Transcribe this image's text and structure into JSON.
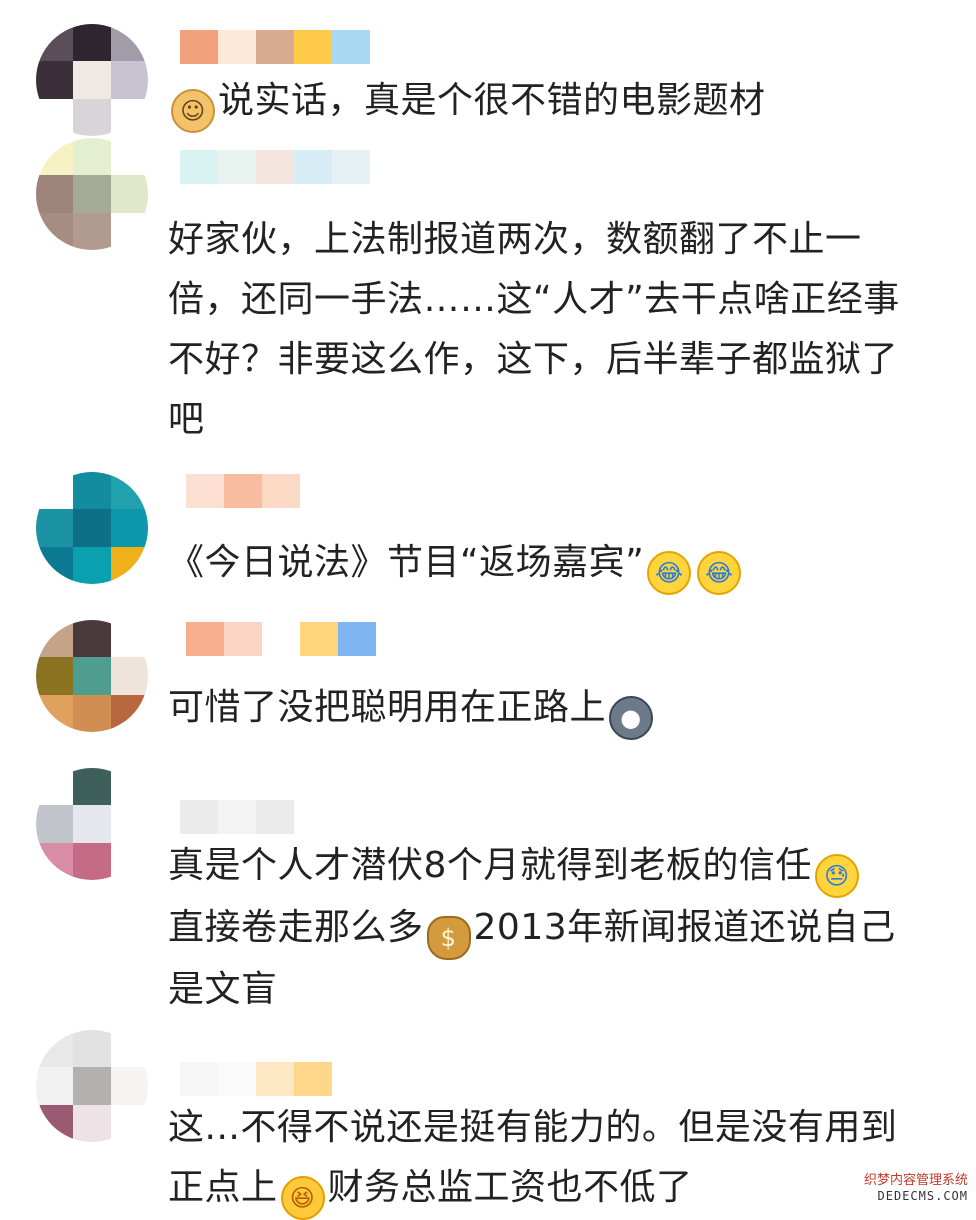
{
  "comments": [
    {
      "text": "说实话，真是个很不错的电影题材",
      "emoji": "doge-emoji",
      "emoji_glyph": "☺",
      "avatar": [
        "#5a4f58",
        "#2d2530",
        "#a39ca8",
        "#3a2f38",
        "#efe9e6",
        "#c9c2d0",
        "#ffffff",
        "#d9d4d8",
        "#ffffff"
      ],
      "name_colors": [
        "#f0a07a",
        "#fde9d8",
        "#d8aa90",
        "#ffc94a",
        "#a9d8f2"
      ]
    },
    {
      "text_lines": [
        "好家伙，上法制报道两次，数额翻了不止一",
        "倍，还同一手法……这“人才”去干点啥正经事",
        "不好？非要这么作，这下，后半辈子都监狱了",
        "吧"
      ],
      "avatar": [
        "#f6f2c4",
        "#e4efd0",
        "#ffffff",
        "#9c847a",
        "#a5ab96",
        "#dfe8c8",
        "#a78c82",
        "#b19b8e",
        "#ffffff"
      ],
      "name_colors": [
        "#d9f2f2",
        "#e9f3f0",
        "#f4e6de",
        "#d7edf5",
        "#e6f1f6"
      ]
    },
    {
      "text_parts": [
        "《今日说法》节目“返场嘉宾”"
      ],
      "emoji": "crying-laughing-emoji",
      "emoji_glyph": "😂",
      "avatar": [
        "#ffffff",
        "#128c9e",
        "#21a0ae",
        "#1b93a5",
        "#0f6f86",
        "#0c98aa",
        "#0b7a92",
        "#0aa0b0",
        "#f0b01a"
      ],
      "name_colors": [
        "#fde0d2",
        "#f8bca0",
        "#fcd9c4"
      ]
    },
    {
      "text": "可惜了没把聪明用在正路上",
      "emoji": "husky-emoji",
      "emoji_glyph": "●",
      "avatar": [
        "#c3a488",
        "#4b3a3c",
        "#ffffff",
        "#8a7422",
        "#4f9d8e",
        "#efe4dc",
        "#e0a15e",
        "#d08e52",
        "#b8673e"
      ],
      "name_colors": [
        "#f8ad8e",
        "#fbd5c4",
        "#ffffff",
        "#ffd47a",
        "#7fb5f0"
      ]
    },
    {
      "text_lines_parts": [
        [
          "真是个人才潜伏8个月就得到老板的信任",
          "sweat-emoji",
          "😓"
        ],
        [
          "直接卷走那么多",
          "money-bag-emoji",
          "$",
          "2013年新闻报道还说自己"
        ],
        [
          "是文盲"
        ]
      ],
      "avatar": [
        "#ffffff",
        "#3f5f5a",
        "#ffffff",
        "#c2c4cc",
        "#e6e6ee",
        "#ffffff",
        "#d98ca6",
        "#c56b86",
        "#ffffff"
      ],
      "name_colors": [
        "#ebebeb",
        "#f3f3f3",
        "#ebebeb"
      ]
    },
    {
      "text_lines_parts": [
        [
          "这...不得不说还是挺有能力的。但是没有用到"
        ],
        [
          "正点上",
          "laugh-emoji",
          "😆",
          "财务总监工资也不低了"
        ]
      ],
      "avatar": [
        "#e8e8e8",
        "#e2e2e2",
        "#ffffff",
        "#f1f1f1",
        "#b5b0b0",
        "#f6f3f3",
        "#9a5a72",
        "#ede2e5",
        "#ffffff"
      ],
      "name_colors": [
        "#f7f7f7",
        "#fafafa",
        "#ffe9c4",
        "#ffd78a"
      ]
    }
  ],
  "watermark": {
    "line1": "织梦内容管理系统",
    "line2": "DEDECMS.COM"
  }
}
